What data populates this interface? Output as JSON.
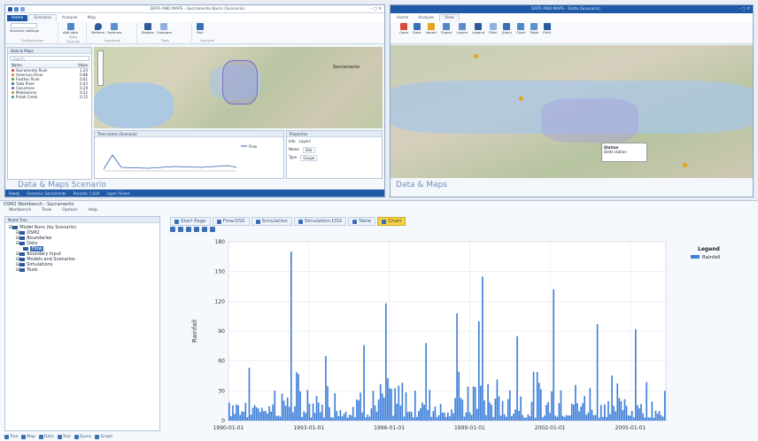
{
  "top_left_window": {
    "title": "DATA AND MAPS - Sacramento Basin (Scenario)",
    "tabs": [
      "Home",
      "Scenario",
      "Analyze",
      "Map"
    ],
    "ribbon_groups": [
      {
        "label": "Configuration",
        "buttons": [
          "Scenario settings"
        ]
      },
      {
        "label": "Data Sources",
        "buttons": [
          "Add data"
        ]
      },
      {
        "label": "Locations",
        "buttons": [
          "Markers",
          "Features"
        ]
      },
      {
        "label": "Tools",
        "buttons": [
          "Browse",
          "Compare"
        ]
      },
      {
        "label": "Analysis",
        "buttons": [
          "Run"
        ]
      }
    ],
    "left_panel": {
      "header": "Data & Maps",
      "search_placeholder": "Search",
      "columns": [
        "Name",
        "Value"
      ],
      "rows": [
        {
          "name": "Sacramento River",
          "value": "1.24"
        },
        {
          "name": "American River",
          "value": "0.88"
        },
        {
          "name": "Feather River",
          "value": "0.61"
        },
        {
          "name": "Yuba River",
          "value": "0.43"
        },
        {
          "name": "Cosumnes",
          "value": "0.29"
        },
        {
          "name": "Mokelumne",
          "value": "0.22"
        },
        {
          "name": "Putah Creek",
          "value": "0.15"
        }
      ]
    },
    "map_city": "Sacramento",
    "chart_panel": {
      "header": "Time series (Scenario)",
      "legend": "Flow"
    },
    "props_panel": {
      "header": "Properties",
      "tabs": [
        "Info",
        "Layers"
      ],
      "fields": [
        {
          "label": "Name",
          "value": "Site"
        },
        {
          "label": "Type",
          "value": "Gauge"
        }
      ]
    },
    "scenario_label": "Data & Maps  Scenario",
    "status": [
      "Ready",
      "Scenario: Sacramento",
      "Records: 1,024",
      "Layer: Rivers"
    ]
  },
  "top_right_window": {
    "title": "DATA AND MAPS - Delta (Scenario)",
    "tabs": [
      "Home",
      "Analyze",
      "View"
    ],
    "ribbon_buttons": [
      "Open",
      "Save",
      "Import",
      "Export",
      "Layers",
      "Legend",
      "Filter",
      "Query",
      "Chart",
      "Table",
      "Print"
    ],
    "scenario_label": "Data & Maps",
    "popup_title": "Station",
    "popup_text": "Delta station"
  },
  "bottom_window": {
    "title": "DSM2 Workbench - Sacramento",
    "menu": [
      "Workbench",
      "Tools",
      "Options",
      "Help"
    ],
    "tree_header": "Model Tree",
    "tree": [
      {
        "label": "Model Runs (by Scenario)",
        "level": 0
      },
      {
        "label": "DSM2",
        "level": 1
      },
      {
        "label": "Boundaries",
        "level": 1
      },
      {
        "label": "Data",
        "level": 1
      },
      {
        "label": "Flow",
        "level": 2,
        "selected": true
      },
      {
        "label": "Boundary Input",
        "level": 1
      },
      {
        "label": "Models and Scenarios",
        "level": 1
      },
      {
        "label": "Simulations",
        "level": 1
      },
      {
        "label": "Tools",
        "level": 1
      }
    ],
    "doc_tabs": [
      {
        "label": "Start Page",
        "active": false
      },
      {
        "label": "Flow.DSS",
        "active": false
      },
      {
        "label": "Simulation",
        "active": false
      },
      {
        "label": "Simulation.DSS",
        "active": false
      },
      {
        "label": "Table",
        "active": false
      },
      {
        "label": "Chart",
        "active": true
      }
    ],
    "bottom_tools": [
      "Tree",
      "Map",
      "Data",
      "Text",
      "Query",
      "Graph"
    ]
  },
  "chart_data": {
    "type": "bar",
    "ylabel": "Rainfall",
    "ylim": [
      0,
      180
    ],
    "yticks": [
      "0",
      "30",
      "60",
      "90",
      "120",
      "150",
      "180"
    ],
    "xticks": [
      "1990-01-01",
      "1993-01-01",
      "1996-01-01",
      "1999-01-01",
      "2002-01-01",
      "2005-01-01"
    ],
    "legend_title": "Legend",
    "series": [
      {
        "name": "Rainfall",
        "color": "#3f7fd8"
      }
    ],
    "peaks": [
      {
        "x": 0.14,
        "v": 170
      },
      {
        "x": 0.22,
        "v": 65
      },
      {
        "x": 0.31,
        "v": 76
      },
      {
        "x": 0.36,
        "v": 118
      },
      {
        "x": 0.45,
        "v": 78
      },
      {
        "x": 0.52,
        "v": 108
      },
      {
        "x": 0.57,
        "v": 100
      },
      {
        "x": 0.58,
        "v": 145
      },
      {
        "x": 0.66,
        "v": 85
      },
      {
        "x": 0.74,
        "v": 132
      },
      {
        "x": 0.84,
        "v": 97
      },
      {
        "x": 0.93,
        "v": 92
      }
    ]
  },
  "colors": {
    "accent": "#1e5aa8",
    "bar": "#3f7fd8",
    "active_tab": "#f3d24b"
  }
}
